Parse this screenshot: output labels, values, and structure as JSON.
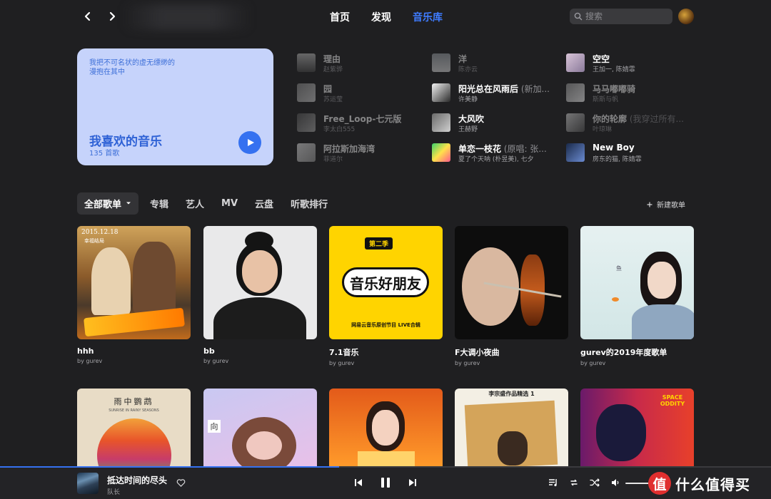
{
  "topbar": {
    "tabs": [
      {
        "label": "首页",
        "active": false
      },
      {
        "label": "发现",
        "active": false
      },
      {
        "label": "音乐库",
        "active": true
      }
    ],
    "search_placeholder": "搜索"
  },
  "favorite": {
    "lyric": "我把不可名状的虚无缥缈的\n漫抱在其中",
    "title": "我喜欢的音乐",
    "count": "135 首歌"
  },
  "recent_tracks": [
    {
      "name": "理由",
      "artist": "赵紫骅",
      "dim": true
    },
    {
      "name": "洋",
      "artist": "陈亦云",
      "dim": true
    },
    {
      "name": "空空",
      "artist": "王加一, 陈婧霏",
      "dim": false
    },
    {
      "name": "园",
      "artist": "苏运莹",
      "dim": true
    },
    {
      "name": "阳光总在风雨后",
      "sub": " (新加...",
      "artist": "许美静",
      "dim": false
    },
    {
      "name": "马马嘟嘟骑",
      "artist": "斯斯与帆",
      "dim": true
    },
    {
      "name": "Free_Loop-七元版",
      "artist": "李太白555",
      "dim": true
    },
    {
      "name": "大风吹",
      "artist": "王赫野",
      "dim": false
    },
    {
      "name": "你的轮廓",
      "sub": " (我穿过所有...",
      "artist": "叶琼琳",
      "dim": true
    },
    {
      "name": "阿拉斯加海湾",
      "artist": "菲道尔",
      "dim": true
    },
    {
      "name": "单恋一枝花",
      "sub": " (原唱: 张...",
      "artist": "夏了个天呐 (朴昱美), 七夕",
      "dim": false
    },
    {
      "name": "New Boy",
      "artist": "房东的猫, 陈婧霏",
      "dim": false
    }
  ],
  "library_tabs": [
    {
      "label": "全部歌单",
      "active": true
    },
    {
      "label": "专辑",
      "active": false
    },
    {
      "label": "艺人",
      "active": false
    },
    {
      "label": "MV",
      "active": false
    },
    {
      "label": "云盘",
      "active": false
    },
    {
      "label": "听歌排行",
      "active": false
    }
  ],
  "new_playlist_label": "新建歌单",
  "playlists": [
    {
      "title": "hhh",
      "by": "by gurev",
      "cover_text": "2015.12.18",
      "cover_sub": "幸福结局"
    },
    {
      "title": "bb",
      "by": "by gurev"
    },
    {
      "title": "7.1音乐",
      "by": "by gurev",
      "cover_badge": "第二季",
      "cover_text": "音乐好朋友",
      "cover_sub": "网易云音乐原创节目 LIVE合辑"
    },
    {
      "title": "F大调小夜曲",
      "by": "by gurev"
    },
    {
      "title": "gurev的2019年度歌单",
      "by": "by gurev",
      "cover_text": "鱼"
    },
    {
      "title": "",
      "by": "",
      "cover_text": "雨中鹦鹉",
      "cover_sub": "SUNRISE IN RAINY SEASONS"
    },
    {
      "title": "",
      "by": "",
      "cover_text": "向"
    },
    {
      "title": "",
      "by": ""
    },
    {
      "title": "",
      "by": "",
      "cover_text": "李宗盛作品精选 1"
    },
    {
      "title": "",
      "by": "",
      "cover_text": "SPACE ODDITY"
    }
  ],
  "player": {
    "title": "抵达时间的尽头",
    "artist": "队长",
    "progress": 0.44
  },
  "watermark": {
    "logo": "值",
    "text": "什么值得买"
  },
  "colors": {
    "accent": "#3571f0",
    "background": "#1f1f21",
    "favorite_card": "#c6d3fb"
  }
}
